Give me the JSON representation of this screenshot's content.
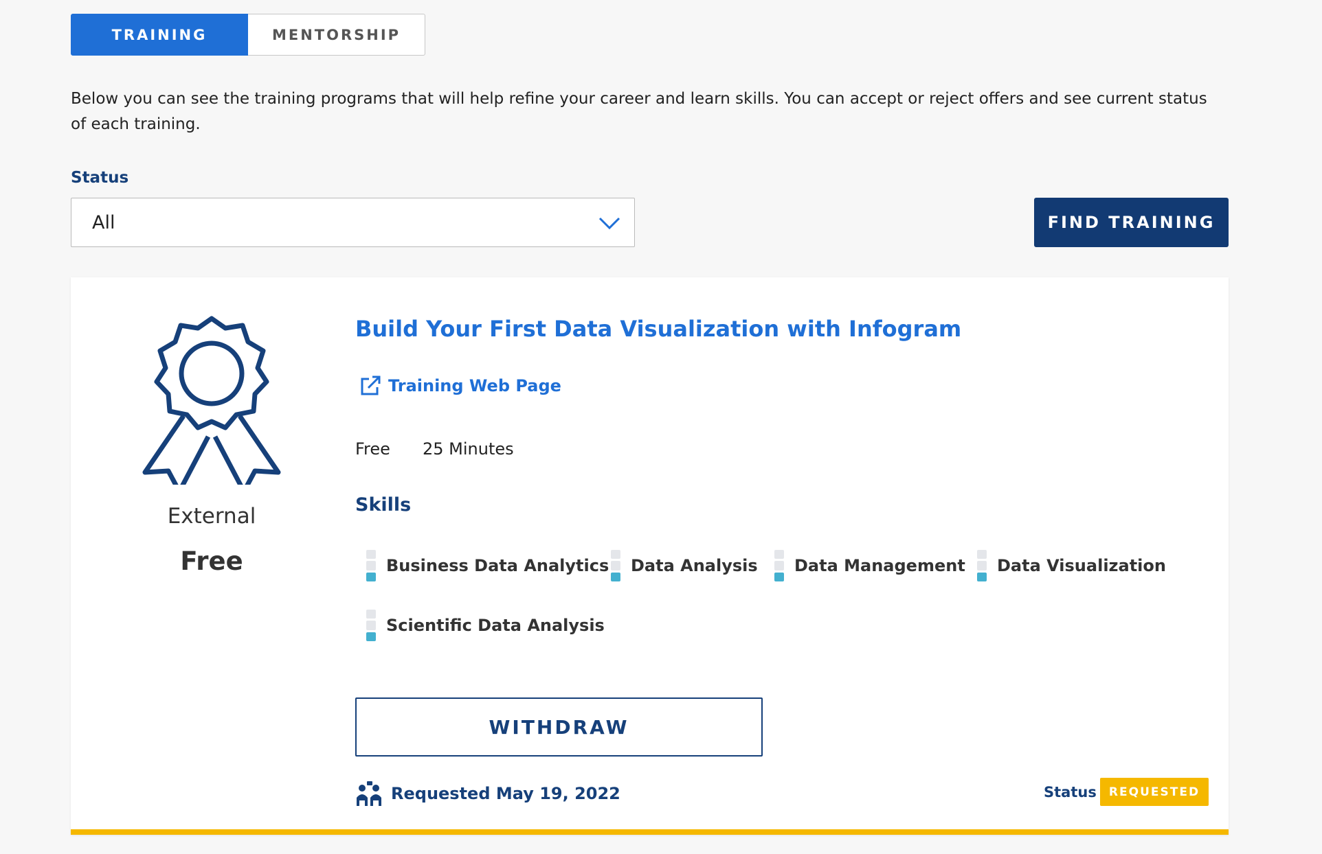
{
  "tabs": [
    {
      "label": "TRAINING",
      "active": true
    },
    {
      "label": "MENTORSHIP",
      "active": false
    }
  ],
  "intro_text": "Below you can see the training programs that will help refine your career and learn skills. You can accept or reject offers and see current status of each training.",
  "filter": {
    "label": "Status",
    "selected": "All"
  },
  "find_button": "FIND TRAINING",
  "card": {
    "type": "External",
    "price": "Free",
    "title": "Build Your First Data Visualization with Infogram",
    "web_link": "Training Web Page",
    "cost": "Free",
    "duration": "25 Minutes",
    "skills_heading": "Skills",
    "skills": [
      {
        "name": "Business Data Analytics",
        "level": 1
      },
      {
        "name": "Data Analysis",
        "level": 1
      },
      {
        "name": "Data Management",
        "level": 1
      },
      {
        "name": "Data Visualization",
        "level": 1
      },
      {
        "name": "Scientific Data Analysis",
        "level": 1
      }
    ],
    "withdraw_button": "WITHDRAW",
    "requested_text": "Requested May 19, 2022",
    "status_label": "Status",
    "status_value": "REQUESTED"
  },
  "colors": {
    "primary_blue": "#1f6fd6",
    "navy": "#123a73",
    "status_yellow": "#f5b800",
    "skill_meter": "#43b0cf"
  }
}
